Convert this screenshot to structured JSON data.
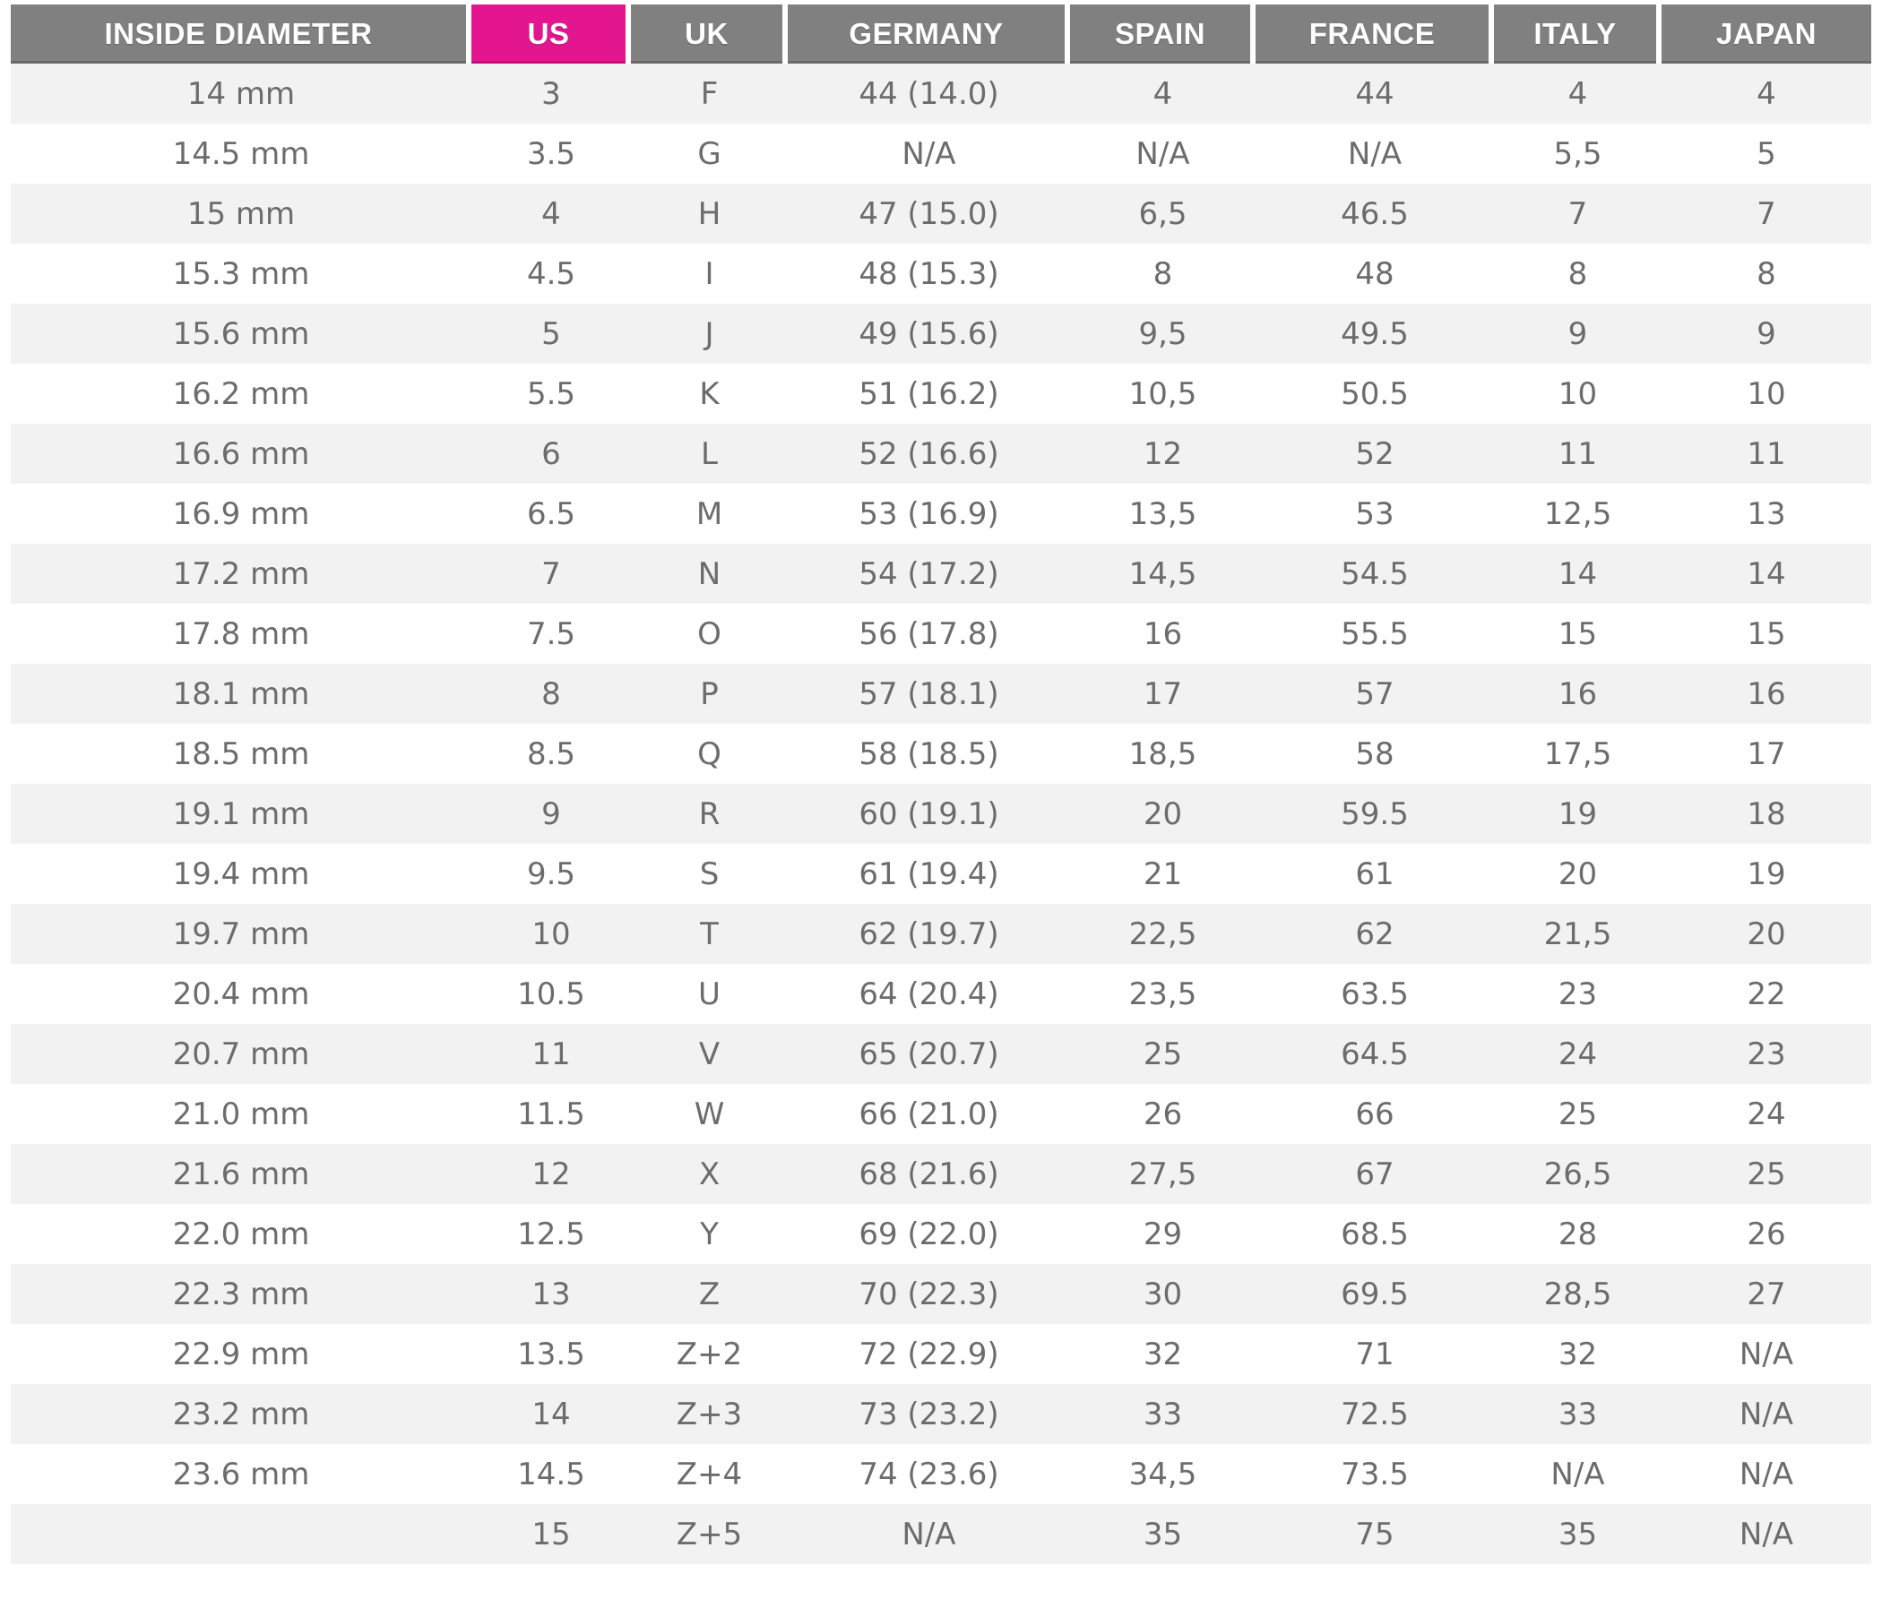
{
  "table": {
    "highlight_color": "#e3168f",
    "header_color": "#808080",
    "columns": [
      "INSIDE DIAMETER",
      "US",
      "UK",
      "GERMANY",
      "SPAIN",
      "FRANCE",
      "ITALY",
      "JAPAN"
    ],
    "rows": [
      [
        "14 mm",
        "3",
        "F",
        "44 (14.0)",
        "4",
        "44",
        "4",
        "4"
      ],
      [
        "14.5 mm",
        "3.5",
        "G",
        "N/A",
        "N/A",
        "N/A",
        "5,5",
        "5"
      ],
      [
        "15 mm",
        "4",
        "H",
        "47 (15.0)",
        "6,5",
        "46.5",
        "7",
        "7"
      ],
      [
        "15.3 mm",
        "4.5",
        "I",
        "48 (15.3)",
        "8",
        "48",
        "8",
        "8"
      ],
      [
        "15.6 mm",
        "5",
        "J",
        "49 (15.6)",
        "9,5",
        "49.5",
        "9",
        "9"
      ],
      [
        "16.2 mm",
        "5.5",
        "K",
        "51 (16.2)",
        "10,5",
        "50.5",
        "10",
        "10"
      ],
      [
        "16.6 mm",
        "6",
        "L",
        "52 (16.6)",
        "12",
        "52",
        "11",
        "11"
      ],
      [
        "16.9 mm",
        "6.5",
        "M",
        "53 (16.9)",
        "13,5",
        "53",
        "12,5",
        "13"
      ],
      [
        "17.2 mm",
        "7",
        "N",
        "54 (17.2)",
        "14,5",
        "54.5",
        "14",
        "14"
      ],
      [
        "17.8 mm",
        "7.5",
        "O",
        "56 (17.8)",
        "16",
        "55.5",
        "15",
        "15"
      ],
      [
        "18.1 mm",
        "8",
        "P",
        "57 (18.1)",
        "17",
        "57",
        "16",
        "16"
      ],
      [
        "18.5 mm",
        "8.5",
        "Q",
        "58 (18.5)",
        "18,5",
        "58",
        "17,5",
        "17"
      ],
      [
        "19.1 mm",
        "9",
        "R",
        "60 (19.1)",
        "20",
        "59.5",
        "19",
        "18"
      ],
      [
        "19.4 mm",
        "9.5",
        "S",
        "61 (19.4)",
        "21",
        "61",
        "20",
        "19"
      ],
      [
        "19.7 mm",
        "10",
        "T",
        "62 (19.7)",
        "22,5",
        "62",
        "21,5",
        "20"
      ],
      [
        "20.4 mm",
        "10.5",
        "U",
        "64 (20.4)",
        "23,5",
        "63.5",
        "23",
        "22"
      ],
      [
        "20.7 mm",
        "11",
        "V",
        "65 (20.7)",
        "25",
        "64.5",
        "24",
        "23"
      ],
      [
        "21.0 mm",
        "11.5",
        "W",
        "66 (21.0)",
        "26",
        "66",
        "25",
        "24"
      ],
      [
        "21.6 mm",
        "12",
        "X",
        "68 (21.6)",
        "27,5",
        "67",
        "26,5",
        "25"
      ],
      [
        "22.0 mm",
        "12.5",
        "Y",
        "69 (22.0)",
        "29",
        "68.5",
        "28",
        "26"
      ],
      [
        "22.3 mm",
        "13",
        "Z",
        "70 (22.3)",
        "30",
        "69.5",
        "28,5",
        "27"
      ],
      [
        "22.9 mm",
        "13.5",
        "Z+2",
        "72 (22.9)",
        "32",
        "71",
        "32",
        "N/A"
      ],
      [
        "23.2 mm",
        "14",
        "Z+3",
        "73 (23.2)",
        "33",
        "72.5",
        "33",
        "N/A"
      ],
      [
        "23.6 mm",
        "14.5",
        "Z+4",
        "74 (23.6)",
        "34,5",
        "73.5",
        "N/A",
        "N/A"
      ],
      [
        "",
        "15",
        "Z+5",
        "N/A",
        "35",
        "75",
        "35",
        "N/A"
      ]
    ]
  }
}
